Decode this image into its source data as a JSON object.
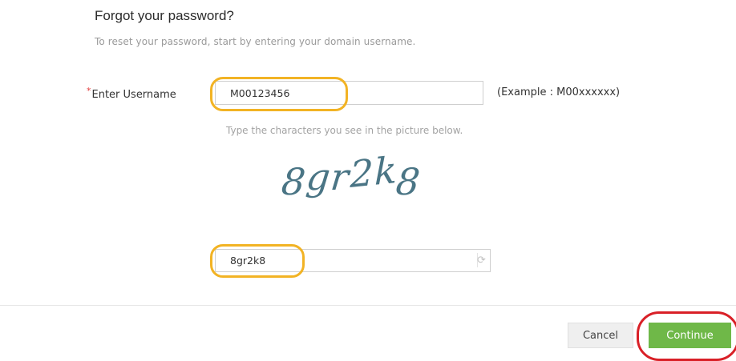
{
  "header": {
    "title": "Forgot your password?",
    "subtitle": "To reset your password, start by entering your domain username."
  },
  "username": {
    "required_mark": "*",
    "label": "Enter Username",
    "value": "M00123456",
    "example": "(Example : M00xxxxxx)"
  },
  "captcha": {
    "hint": "Type the characters you see in the picture below.",
    "image_text": "8gr2k8",
    "value": "8gr2k8",
    "refresh_icon": "refresh-icon"
  },
  "actions": {
    "cancel_label": "Cancel",
    "continue_label": "Continue"
  },
  "colors": {
    "highlight": "#f2b324",
    "continue_bg": "#6fb848",
    "red_ring": "#d92027",
    "required": "#e23b3b"
  }
}
